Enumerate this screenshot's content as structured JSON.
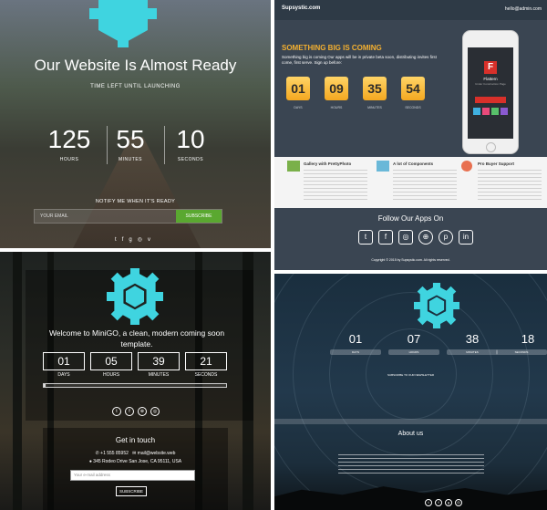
{
  "panel1": {
    "title": "Our Website Is Almost Ready",
    "time_left_label": "TIME LEFT UNTIL LAUNCHING",
    "countdown": [
      {
        "value": "125",
        "label": "HOURS"
      },
      {
        "value": "55",
        "label": "MINUTES"
      },
      {
        "value": "10",
        "label": "SECONDS"
      }
    ],
    "notify_label": "NOTIFY ME WHEN IT'S READY",
    "email_placeholder": "YOUR EMAIL",
    "subscribe_label": "SUBSCRIBE",
    "social_icons": [
      "twitter-icon",
      "facebook-icon",
      "google-plus-icon",
      "instagram-icon",
      "vimeo-icon"
    ],
    "accent_color": "#3fd4e0",
    "button_color": "#5aa830"
  },
  "panel2": {
    "brand": "Supsystic.com",
    "contact_email": "hello@admin.com",
    "headline": "SOMETHING BIG IS COMING",
    "description": "Something big is coming Our apps will be in private beta soon, distributing invites first come, first serve. Sign up before:",
    "countdown": [
      {
        "value": "01",
        "label": "DAYS"
      },
      {
        "value": "09",
        "label": "HOURS"
      },
      {
        "value": "35",
        "label": "MINUTES"
      },
      {
        "value": "54",
        "label": "SECONDS"
      }
    ],
    "phone_app_letter": "F",
    "phone_app_name": "Flattern",
    "phone_app_subtitle": "Under Construction Page",
    "features": [
      {
        "title": "Gallery with PrettyPhoto"
      },
      {
        "title": "A lot of Components"
      },
      {
        "title": "Pro Buyer Support"
      }
    ],
    "follow_label": "Follow Our Apps On",
    "social_icons": [
      "twitter-icon",
      "facebook-icon",
      "instagram-icon",
      "dribbble-icon",
      "pinterest-icon",
      "linkedin-icon"
    ],
    "copyright": "Copyright © 2015 by Supsystic.com. All rights reserved.",
    "accent_color": "#f4b030"
  },
  "panel3": {
    "welcome": "Welcome to MiniGO, a clean, modern coming soon template.",
    "countdown": [
      {
        "value": "01",
        "label": "DAYS"
      },
      {
        "value": "05",
        "label": "HOURS"
      },
      {
        "value": "39",
        "label": "MINUTES"
      },
      {
        "value": "21",
        "label": "SECONDS"
      }
    ],
    "progress_fraction": 0.01,
    "social_icons": [
      "twitter-icon",
      "facebook-icon",
      "dribbble-icon",
      "instagram-icon"
    ],
    "get_in_touch": "Get in touch",
    "phone": "+1 555 85952",
    "email": "mail@website.web",
    "address": "345 Rodeo Drive San Jose, CA 95111, USA",
    "email_placeholder": "Your e-mail address",
    "subscribe_label": "SUBSCRIBE"
  },
  "panel4": {
    "countdown": [
      {
        "value": "01",
        "label": "DAYS"
      },
      {
        "value": "07",
        "label": "HOURS"
      },
      {
        "value": "38",
        "label": "MINUTES"
      },
      {
        "value": "18",
        "label": "SECONDS"
      }
    ],
    "subscribe_note": "SUBSCRIBE TO OUR NEWSLETTER",
    "about_title": "About us",
    "social_icons": [
      "twitter-icon",
      "facebook-icon",
      "google-plus-icon",
      "instagram-icon"
    ]
  }
}
